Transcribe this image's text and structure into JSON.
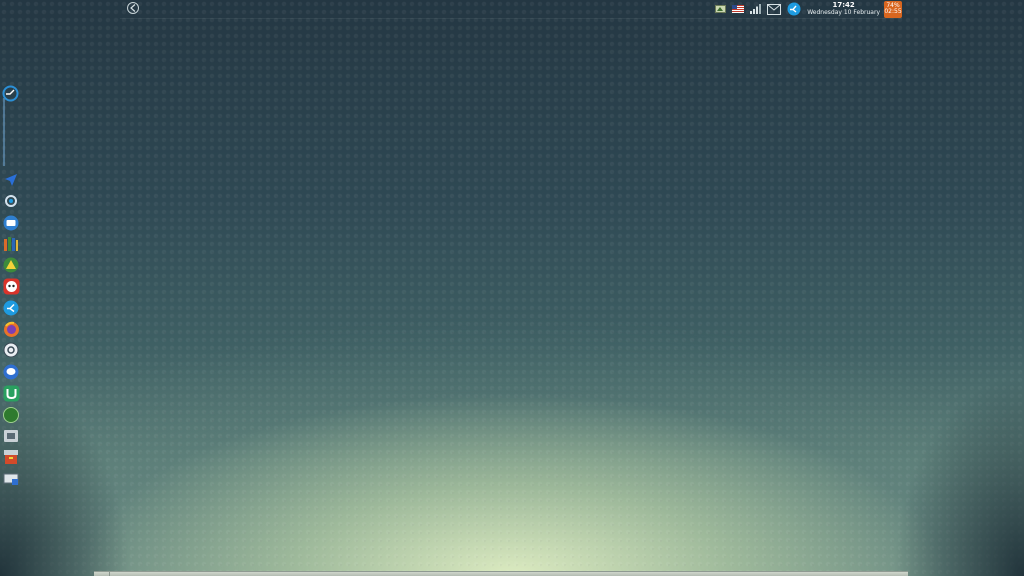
{
  "panel": {
    "clock_time": "17:42",
    "clock_date": "Wednesday 10 February",
    "battery_percent": "74%",
    "battery_time": "02:55"
  },
  "icons": {
    "back": "back-arrow-icon",
    "tray": [
      "network-icon",
      "us-flag-keyboard-icon",
      "signal-bars-icon",
      "mail-icon",
      "update-icon"
    ],
    "dock": [
      "launcher-icon",
      "navigation-arrow-icon",
      "screen-settings-icon",
      "file-manager-icon",
      "library-books-icon",
      "photo-editor-icon",
      "panda-app-icon",
      "sync-icon",
      "firefox-icon",
      "mail-client-icon",
      "chat-bubble-icon",
      "torrent-icon",
      "green-disk-icon",
      "media-icon",
      "archive-icon",
      "remote-desktop-icon"
    ]
  },
  "colors": {
    "battery_bg": "#d9661f",
    "accent_blue": "#1e9be0"
  }
}
